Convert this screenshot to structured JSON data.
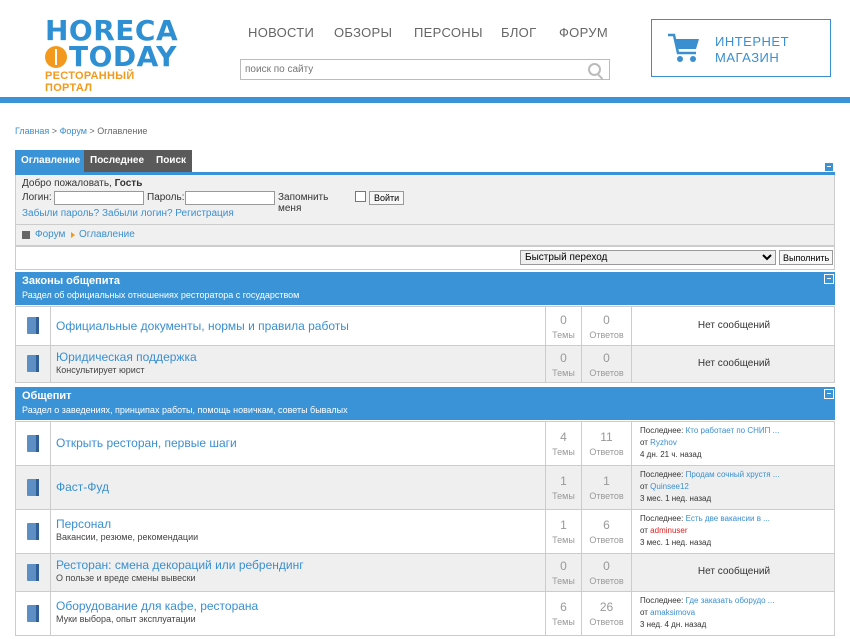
{
  "logo": {
    "line1": "HORECA",
    "line2": "TODAY",
    "tagline": "РЕСТОРАННЫЙ ПОРТАЛ"
  },
  "nav": {
    "items": [
      "НОВОСТИ",
      "ОБЗОРЫ",
      "ПЕРСОНЫ",
      "БЛОГ",
      "ФОРУМ"
    ]
  },
  "search": {
    "placeholder": "поиск по сайту"
  },
  "shop": {
    "line1": "ИНТЕРНЕТ",
    "line2": "МАГАЗИН"
  },
  "breadcrumb": {
    "home": "Главная",
    "forum": "Форум",
    "current": "Оглавление",
    "sep": ">"
  },
  "tabs": [
    "Оглавление",
    "Последнее",
    "Поиск"
  ],
  "login": {
    "welcome": "Добро пожаловать,",
    "guest": "Гость",
    "login_label": "Логин:",
    "password_label": "Пароль:",
    "remember_label": "Запомнить меня",
    "submit": "Войти",
    "links": "Забыли пароль? Забыли логин? Регистрация"
  },
  "path": {
    "forum": "Форум",
    "current": "Оглавление"
  },
  "jump": {
    "selected": "Быстрый переход",
    "button": "Выполнить"
  },
  "categories": [
    {
      "title": "Законы общепита",
      "desc": "Раздел об официальных отношениях ресторатора с государством",
      "forums": [
        {
          "name": "Официальные документы, нормы и правила работы",
          "desc": "",
          "topics": "0",
          "replies": "0",
          "last": "Нет сообщений"
        },
        {
          "name": "Юридическая поддержка",
          "desc": "Консультирует юрист",
          "topics": "0",
          "replies": "0",
          "last": "Нет сообщений"
        }
      ]
    },
    {
      "title": "Общепит",
      "desc": "Раздел о заведениях, принципах работы, помощь новичкам, советы бывалых",
      "forums": [
        {
          "name": "Открыть ресторан, первые шаги",
          "desc": "",
          "topics": "4",
          "replies": "11",
          "last_title": "Кто работает по СНИП ...",
          "last_by": "Ryzhov",
          "last_time": "4 дн. 21 ч. назад"
        },
        {
          "name": "Фаст-Фуд",
          "desc": "",
          "topics": "1",
          "replies": "1",
          "last_title": "Продам сочный хрустя ...",
          "last_by": "Quinsee12",
          "last_time": "3 мес. 1 нед. назад"
        },
        {
          "name": "Персонал",
          "desc": "Вакансии, резюме, рекомендации",
          "topics": "1",
          "replies": "6",
          "last_title": "Есть две вакансии в ...",
          "last_by": "adminuser",
          "last_time": "3 мес. 1 нед. назад"
        },
        {
          "name": "Ресторан: смена декораций или ребрендинг",
          "desc": "О пользе и вреде смены вывески",
          "topics": "0",
          "replies": "0",
          "last": "Нет сообщений"
        },
        {
          "name": "Оборудование для кафе, ресторана",
          "desc": "Муки выбора, опыт эксплуатации",
          "topics": "6",
          "replies": "26",
          "last_title": "Где заказать оборудо ...",
          "last_by": "amaksimova",
          "last_time": "3 нед. 4 дн. назад"
        }
      ]
    }
  ],
  "labels": {
    "topics": "Темы",
    "replies": "Ответов",
    "last_prefix": "Последнее:",
    "by": "от"
  },
  "colors": {
    "brand_blue": "#3a93d6",
    "brand_orange": "#f39a1e",
    "tab_dark": "#5a5a5a",
    "admin_red": "#dd2222"
  }
}
